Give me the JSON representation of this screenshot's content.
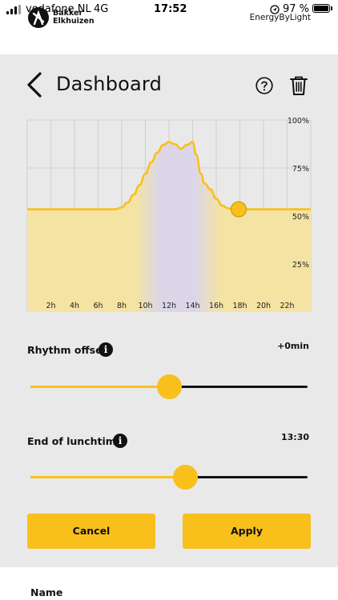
{
  "status_bar": {
    "carrier": "vodafone NL",
    "network": "4G",
    "time": "17:52",
    "battery": "97 %"
  },
  "header": {
    "brand_line1": "Bakker",
    "brand_line2": "Elkhuizen",
    "product": "EnergyByLight"
  },
  "page": {
    "title": "Dashboard"
  },
  "colors": {
    "accent": "#f9c01c",
    "area_fill": "#f5e3a3",
    "lunch_band": "#dcd6e8",
    "background": "#e9e9e9"
  },
  "chart_data": {
    "type": "area",
    "x_ticks": [
      "2h",
      "4h",
      "6h",
      "8h",
      "10h",
      "12h",
      "14h",
      "16h",
      "18h",
      "20h",
      "22h"
    ],
    "y_ticks": [
      "100%",
      "75%",
      "50%",
      "25%"
    ],
    "xlim": [
      0,
      24
    ],
    "ylim": [
      0,
      100
    ],
    "grid": true,
    "x": [
      0,
      2,
      4,
      6,
      7.5,
      8,
      8.5,
      9,
      9.5,
      10,
      10.5,
      11,
      11.5,
      12,
      12.5,
      13,
      13.5,
      14,
      14.3,
      14.7,
      15,
      15.5,
      16,
      16.5,
      17,
      17.5,
      18,
      20,
      22,
      24
    ],
    "y": [
      53.5,
      53.5,
      53.5,
      53.5,
      53.5,
      54.5,
      57,
      61,
      66,
      72,
      78,
      83,
      87,
      88.5,
      87.5,
      85,
      87,
      88.5,
      82,
      72,
      67,
      64,
      59,
      55.5,
      54,
      53.5,
      53.5,
      53.5,
      53.5,
      53.5
    ],
    "current_marker": {
      "x": 17.9,
      "y": 53.5
    },
    "lunch_band": {
      "start": 9.2,
      "end": 16.4,
      "peak_start": 11.2,
      "peak_end": 14.2
    }
  },
  "rhythm_offset": {
    "label": "Rhythm offset",
    "value": "+0min",
    "info_icon": "info-icon",
    "position": 0.5
  },
  "end_of_lunchtime": {
    "label": "End of lunchtime",
    "value": "13:30",
    "info_icon": "info-icon",
    "position": 0.56
  },
  "actions": {
    "cancel_label": "Cancel",
    "apply_label": "Apply"
  },
  "bottom_sheet": {
    "name_label": "Name"
  },
  "icons": {
    "back": "chevron-left-icon",
    "help": "help-icon",
    "delete": "trash-icon",
    "signal": "signal-icon",
    "location": "location-icon",
    "battery": "battery-icon"
  }
}
